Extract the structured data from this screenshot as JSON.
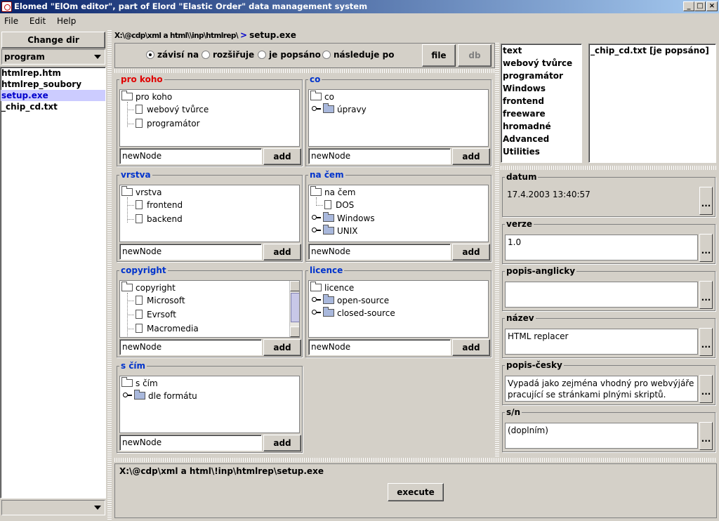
{
  "window": {
    "title": "Elomed \"ElOm editor\", part of Elord \"Elastic Order\" data management system",
    "min": "_",
    "max": "□",
    "close": "×"
  },
  "menu": [
    "File",
    "Edit",
    "Help"
  ],
  "left": {
    "change_dir": "Change dir",
    "combo_value": "program",
    "files": [
      "htmlrep.htm",
      "htmlrep_soubory",
      "setup.exe",
      "_chip_cd.txt"
    ],
    "selected_index": 2
  },
  "path": {
    "prefix": "X:\\@cdp\\xml a html\\\\inp\\htmlrep\\",
    "arrow": ">",
    "file": "setup.exe"
  },
  "relations": {
    "options": [
      "závisí na",
      "rozšiřuje",
      "je popsáno",
      "následuje po"
    ],
    "selected": "závisí na",
    "file_btn": "file",
    "db_btn": "db"
  },
  "groups": [
    {
      "title": "pro koho",
      "root": "pro koho",
      "children": [
        {
          "label": "webový tvůrce",
          "kind": "doc"
        },
        {
          "label": "programátor",
          "kind": "doc"
        }
      ],
      "input": "newNode",
      "add": "add"
    },
    {
      "title": "co",
      "root": "co",
      "children": [
        {
          "label": "úpravy",
          "kind": "folder"
        }
      ],
      "input": "newNode",
      "add": "add"
    },
    {
      "title": "vrstva",
      "root": "vrstva",
      "children": [
        {
          "label": "frontend",
          "kind": "doc"
        },
        {
          "label": "backend",
          "kind": "doc"
        }
      ],
      "input": "newNode",
      "add": "add"
    },
    {
      "title": "na čem",
      "root": "na čem",
      "children": [
        {
          "label": "DOS",
          "kind": "doc"
        },
        {
          "label": "Windows",
          "kind": "folder"
        },
        {
          "label": "UNIX",
          "kind": "folder"
        }
      ],
      "input": "newNode",
      "add": "add"
    },
    {
      "title": "copyright",
      "root": "copyright",
      "children": [
        {
          "label": "Microsoft",
          "kind": "doc"
        },
        {
          "label": "Evrsoft",
          "kind": "doc"
        },
        {
          "label": "Macromedia",
          "kind": "doc"
        }
      ],
      "input": "newNode",
      "add": "add"
    },
    {
      "title": "licence",
      "root": "licence",
      "children": [
        {
          "label": "open-source",
          "kind": "folder"
        },
        {
          "label": "closed-source",
          "kind": "folder"
        }
      ],
      "input": "newNode",
      "add": "add"
    },
    {
      "title": "s čím",
      "root": "s čím",
      "children": [
        {
          "label": "dle formátu",
          "kind": "folder"
        }
      ],
      "input": "newNode",
      "add": "add"
    }
  ],
  "tags": [
    "text",
    "webový tvůrce",
    "programátor",
    "Windows",
    "frontend",
    "freeware",
    "hromadné",
    "Advanced Utilities"
  ],
  "relations_list": [
    "_chip_cd.txt [je popsáno]"
  ],
  "fields": [
    {
      "label": "datum",
      "value": "17.4.2003 13:40:57",
      "dots": "..."
    },
    {
      "label": "verze",
      "value": "1.0",
      "dots": "..."
    },
    {
      "label": "popis-anglicky",
      "value": "",
      "dots": "..."
    },
    {
      "label": "název",
      "value": "HTML replacer",
      "dots": "..."
    },
    {
      "label": "popis-česky",
      "value": "Vypadá jako zejména vhodný pro webvýjáře pracující se stránkami plnými skriptů.",
      "dots": "..."
    },
    {
      "label": "s/n",
      "value": "(doplním)",
      "dots": "..."
    }
  ],
  "bottom": {
    "path": "X:\\@cdp\\xml a html\\!inp\\htmlrep\\setup.exe",
    "execute": "execute"
  }
}
